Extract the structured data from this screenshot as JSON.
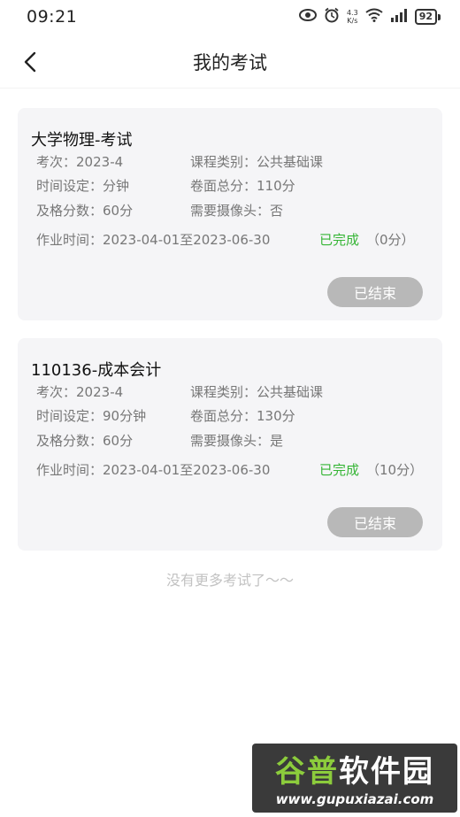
{
  "status_bar": {
    "time": "09:21",
    "speed_value": "4.3",
    "speed_unit": "K/s",
    "battery": "92"
  },
  "nav": {
    "title": "我的考试"
  },
  "exams": [
    {
      "title": "大学物理-考试",
      "session_label": "考次：",
      "session_value": "2023-4",
      "category_label": "课程类别：",
      "category_value": "公共基础课",
      "duration_label": "时间设定：",
      "duration_value": "分钟",
      "total_label": "卷面总分：",
      "total_value": "110分",
      "pass_label": "及格分数：",
      "pass_value": "60分",
      "camera_label": "需要摄像头：",
      "camera_value": "否",
      "time_label": "作业时间：",
      "time_value": "2023-04-01至2023-06-30",
      "status": "已完成",
      "score": "（0分）",
      "button": "已结束"
    },
    {
      "title": "110136-成本会计",
      "session_label": "考次：",
      "session_value": "2023-4",
      "category_label": "课程类别：",
      "category_value": "公共基础课",
      "duration_label": "时间设定：",
      "duration_value": "90分钟",
      "total_label": "卷面总分：",
      "total_value": "130分",
      "pass_label": "及格分数：",
      "pass_value": "60分",
      "camera_label": "需要摄像头：",
      "camera_value": "是",
      "time_label": "作业时间：",
      "time_value": "2023-04-01至2023-06-30",
      "status": "已完成",
      "score": "（10分）",
      "button": "已结束"
    }
  ],
  "footer": {
    "no_more": "没有更多考试了～～"
  },
  "watermark": {
    "brand_part1": "谷普",
    "brand_part2": "软件园",
    "url": "www.gupuxiazai.com"
  },
  "colors": {
    "status_done": "#35b535",
    "button_bg": "#b8b8b8",
    "card_bg": "#f5f5f7"
  }
}
